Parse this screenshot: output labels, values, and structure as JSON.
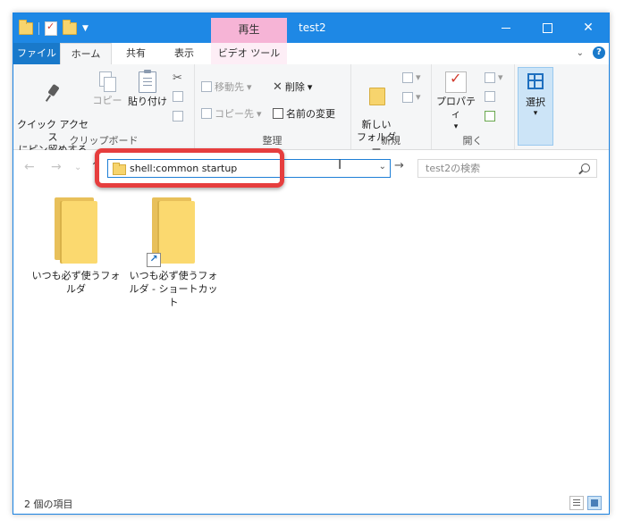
{
  "window": {
    "title": "test2",
    "context_tab": "再生"
  },
  "ribbon_tabs": [
    "ファイル",
    "ホーム",
    "共有",
    "表示",
    "ビデオ ツール"
  ],
  "ribbon": {
    "clipboard": {
      "pin_label": "クイック アクセス\nにピン留めする",
      "copy_label": "コピー",
      "paste_label": "貼り付け",
      "group_label": "クリップボード"
    },
    "organize": {
      "move_to": "移動先",
      "copy_to": "コピー先",
      "delete": "削除",
      "rename": "名前の変更",
      "group_label": "整理"
    },
    "new": {
      "new_folder": "新しい\nフォルダー",
      "group_label": "新規"
    },
    "open": {
      "properties": "プロパティ",
      "group_label": "開く"
    },
    "select": {
      "select_label": "選択"
    }
  },
  "address": {
    "value": "shell:common startup"
  },
  "search": {
    "placeholder": "test2の検索"
  },
  "items": [
    {
      "label": "いつも必ず使うフォルダ",
      "shortcut": false
    },
    {
      "label": "いつも必ず使うフォルダ - ショートカット",
      "shortcut": true
    }
  ],
  "status": {
    "text": "2 個の項目"
  },
  "colors": {
    "titlebar": "#1e88e5",
    "highlight": "#e63e3e",
    "context_tab": "#f6b4d6"
  }
}
